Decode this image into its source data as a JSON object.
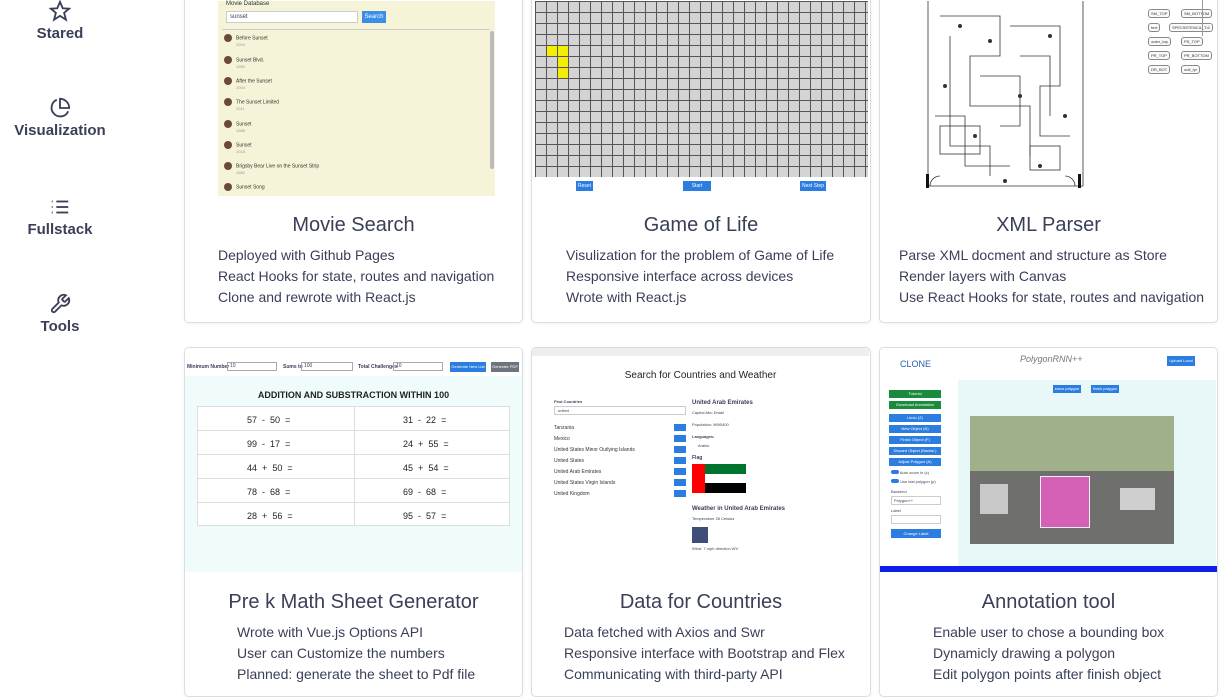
{
  "sidebar": {
    "items": [
      {
        "label": "Stared",
        "icon": "star-icon"
      },
      {
        "label": "Visualization",
        "icon": "pie-chart-icon"
      },
      {
        "label": "Fullstack",
        "icon": "list-icon"
      },
      {
        "label": "Tools",
        "icon": "wrench-icon"
      }
    ]
  },
  "projects": [
    {
      "title": "Movie Search",
      "points": [
        "Deployed with Github Pages",
        "React Hooks for state, routes and navigation",
        "Clone and rewrote with React.js"
      ],
      "thumb": {
        "heading": "Movie Database",
        "search_value": "sunset",
        "search_button": "Search",
        "movies": [
          {
            "name": "Before Sunset",
            "year": "2004"
          },
          {
            "name": "Sunset Blvd.",
            "year": "1950"
          },
          {
            "name": "After the Sunset",
            "year": "2004"
          },
          {
            "name": "The Sunset Limited",
            "year": "2011"
          },
          {
            "name": "Sunset",
            "year": "1988"
          },
          {
            "name": "Sunset",
            "year": "2018"
          },
          {
            "name": "Brigsby Bear Live on the Sunset Strip",
            "year": "1982"
          },
          {
            "name": "Sunset Song",
            "year": "2015"
          }
        ]
      }
    },
    {
      "title": "Game of Life",
      "points": [
        "Visulization for the problem of Game of Life",
        "Responsive interface across devices",
        "Wrote with React.js"
      ],
      "thumb": {
        "buttons": [
          "Reset",
          "Start",
          "Next Step"
        ]
      }
    },
    {
      "title": "XML Parser",
      "points": [
        "Parse XML docment and structure as Store",
        "Render layers with Canvas",
        "Use React Hooks for state, routes and navigation"
      ],
      "thumb": {
        "tags": [
          "SM_TOP",
          "SM_BOTTOM",
          "text",
          "SPEC5STENCIL_T.6",
          "outer_top",
          "PS_TOP",
          "PR_TOP",
          "PR_BOTTOM",
          "DR_BOT",
          "outl_lyr"
        ]
      }
    },
    {
      "title": "Pre k Math Sheet Generator",
      "points": [
        "Wrote with Vue.js Options API",
        "User can Customize the numbers",
        "Planned: generate the sheet to Pdf file"
      ],
      "thumb": {
        "fields": [
          "Minimum Number",
          "Sums to",
          "Total Challenges"
        ],
        "field_values": [
          "10",
          "100",
          "10"
        ],
        "buttons": [
          "Generate New List",
          "Generate PDF"
        ],
        "heading": "ADDITION AND SUBSTRACTION WITHIN 100",
        "problems": [
          [
            "57",
            "-",
            "50",
            "="
          ],
          [
            "31",
            "-",
            "22",
            "="
          ],
          [
            "99",
            "-",
            "17",
            "="
          ],
          [
            "24",
            "+",
            "55",
            "="
          ],
          [
            "44",
            "+",
            "50",
            "="
          ],
          [
            "45",
            "+",
            "54",
            "="
          ],
          [
            "78",
            "-",
            "68",
            "="
          ],
          [
            "69",
            "-",
            "68",
            "="
          ],
          [
            "28",
            "+",
            "56",
            "="
          ],
          [
            "95",
            "-",
            "57",
            "="
          ]
        ]
      }
    },
    {
      "title": "Data for Countries",
      "points": [
        "Data fetched with Axios and Swr",
        "Responsive interface with Bootstrap and Flex",
        "Communicating with third-party API"
      ],
      "thumb": {
        "heading": "Search for Countries and Weather",
        "find_label": "Find Countries",
        "find_value": "united",
        "countries": [
          "Tanzania",
          "Mexico",
          "United States Minor Outlying Islands",
          "United States",
          "United Arab Emirates",
          "United States Virgin Islands",
          "United Kingdom"
        ],
        "detail_title": "United Arab Emirates",
        "capital": "Capital Abu Dhabi",
        "population": "Population: 9890400",
        "languages": "Languages:",
        "language_item": "Arabic",
        "flag_label": "Flag",
        "weather_title": "Weather in United Arab Emirates",
        "temperature": "Temperature 28 Celsius",
        "wind": "Wind: 7 mph direction WV",
        "view_button": "View",
        "flag_colors": [
          "#00732f",
          "#ffffff",
          "#000000",
          "#ff0000"
        ]
      }
    },
    {
      "title": "Annotation tool",
      "points": [
        "Enable user to chose a bounding box",
        "Dynamicly drawing a polygon",
        "Edit polygon points after finish object"
      ],
      "thumb": {
        "clone": "CLONE",
        "logo": "PolygonRNN++",
        "upload": "Upload Local",
        "buttons": [
          "Tutorial",
          "Download Annotation",
          "Undo (Z)",
          "New Object (N)",
          "Finish Object (F)",
          "Discard Object (Backsl.)",
          "Adjust Polygon (A)"
        ],
        "top_buttons": [
          "show polygon",
          "finish polygon"
        ],
        "toggles": [
          "Auto zoom in (z)",
          "Use last polygon (p)"
        ],
        "backend_label": "Backend",
        "backend_value": "Polygon++",
        "label_label": "Label",
        "change_label": "Change Label"
      }
    }
  ],
  "colors": {
    "text": "#3a3f58",
    "accent": "#2b7de0",
    "border": "#dcdde3"
  }
}
